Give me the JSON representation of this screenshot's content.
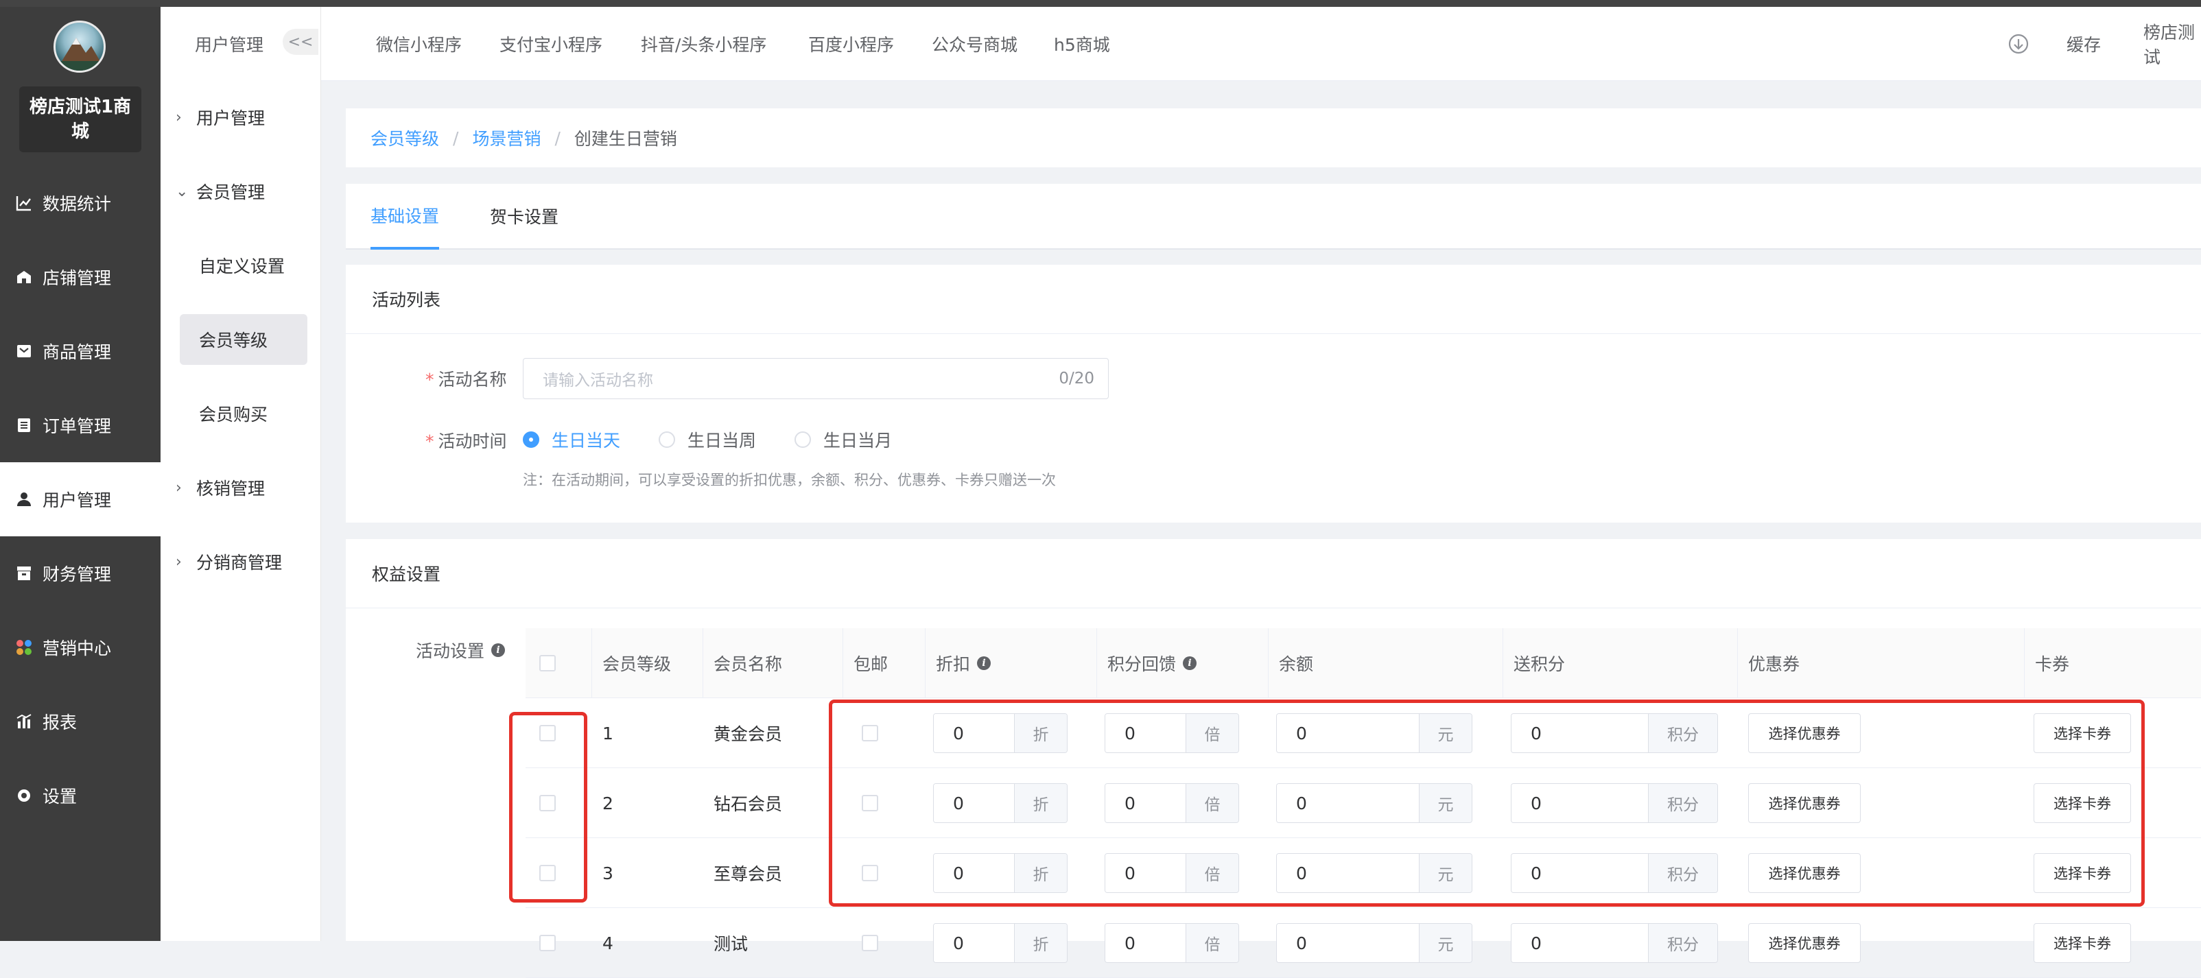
{
  "shop": {
    "name": "榜店测试1商城"
  },
  "sidebar": {
    "items": [
      {
        "label": "数据统计",
        "icon": "chart-icon"
      },
      {
        "label": "店铺管理",
        "icon": "store-icon"
      },
      {
        "label": "商品管理",
        "icon": "goods-icon"
      },
      {
        "label": "订单管理",
        "icon": "order-icon"
      },
      {
        "label": "用户管理",
        "icon": "user-icon"
      },
      {
        "label": "财务管理",
        "icon": "finance-icon"
      },
      {
        "label": "营销中心",
        "icon": "marketing-icon"
      },
      {
        "label": "报表",
        "icon": "report-icon"
      },
      {
        "label": "设置",
        "icon": "settings-icon"
      }
    ],
    "active": "用户管理"
  },
  "subSidebar": {
    "title": "用户管理",
    "collapse": "<<",
    "groups": [
      {
        "label": "用户管理"
      },
      {
        "label": "会员管理"
      },
      {
        "label": "核销管理"
      },
      {
        "label": "分销商管理"
      }
    ],
    "children": [
      {
        "label": "自定义设置"
      },
      {
        "label": "会员等级"
      },
      {
        "label": "会员购买"
      }
    ]
  },
  "topnav": {
    "tabs": [
      "微信小程序",
      "支付宝小程序",
      "抖音/头条小程序",
      "百度小程序",
      "公众号商城",
      "h5商城"
    ],
    "cache": "缓存",
    "user": "榜店测试"
  },
  "breadcrumb": {
    "items": [
      "会员等级",
      "场景营销",
      "创建生日营销"
    ],
    "sep": "/"
  },
  "tabs": {
    "items": [
      "基础设置",
      "贺卡设置"
    ]
  },
  "activity": {
    "section_title": "活动列表",
    "name_label": "活动名称",
    "name_placeholder": "请输入活动名称",
    "name_count": "0/20",
    "time_label": "活动时间",
    "time_options": [
      "生日当天",
      "生日当周",
      "生日当月"
    ],
    "note": "注：在活动期间，可以享受设置的折扣优惠，余额、积分、优惠券、卡券只赠送一次"
  },
  "rights": {
    "section_title": "权益设置",
    "setting_label": "活动设置",
    "headers": [
      "会员等级",
      "会员名称",
      "包邮",
      "折扣",
      "积分回馈",
      "余额",
      "送积分",
      "优惠券",
      "卡券"
    ],
    "units": {
      "discount": "折",
      "points_back": "倍",
      "balance": "元",
      "give_points": "积分"
    },
    "coupon_btn": "选择优惠券",
    "card_btn": "选择卡券",
    "rows": [
      {
        "level": "1",
        "name": "黄金会员",
        "discount": "0",
        "points_back": "0",
        "balance": "0",
        "give_points": "0"
      },
      {
        "level": "2",
        "name": "钻石会员",
        "discount": "0",
        "points_back": "0",
        "balance": "0",
        "give_points": "0"
      },
      {
        "level": "3",
        "name": "至尊会员",
        "discount": "0",
        "points_back": "0",
        "balance": "0",
        "give_points": "0"
      },
      {
        "level": "4",
        "name": "测试",
        "discount": "0",
        "points_back": "0",
        "balance": "0",
        "give_points": "0"
      }
    ]
  },
  "colors": {
    "accent": "#409eff",
    "sidebar_bg": "#3d3d3d",
    "highlight_red": "#e5312a"
  }
}
